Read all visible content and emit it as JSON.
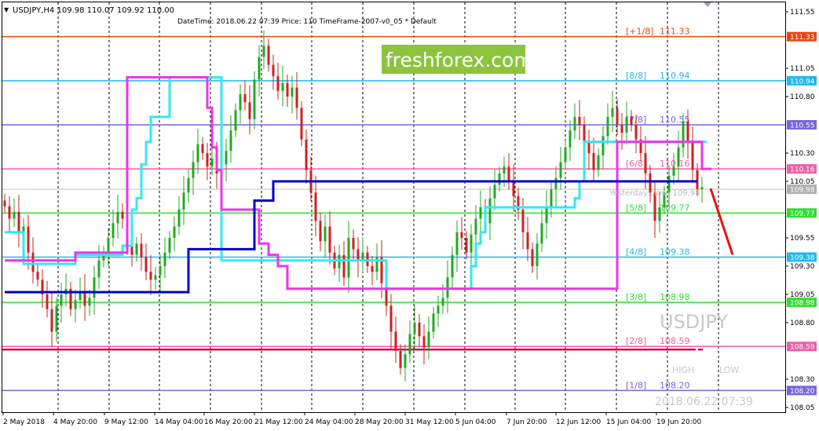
{
  "header": {
    "symbol_line": "USDJPY,H4  109.98 110.07 109.92 110.00",
    "info_line": "DateTime: 2018.06.22 07:39    Price: 110    TimeFrame-2007-v0_05    *   Default"
  },
  "watermark": "freshforex.com",
  "overlay": {
    "symbol": "USDJPY",
    "high_label": "HIGH",
    "low_label": "LOW",
    "datetime": "2018.06.22 07:39",
    "yesterday_close": "Yesterday close 109.98"
  },
  "colors": {
    "bull": "#22aa22",
    "bear": "#cc2222",
    "cyan_line": "#33e8f0",
    "magenta_line": "#ee33ee",
    "blue_line": "#0000cc",
    "arrow": "#ee1111"
  },
  "chart_data": {
    "type": "candlestick",
    "symbol": "USDJPY",
    "timeframe": "H4",
    "ylim": [
      108.05,
      111.55
    ],
    "y_ticks": [
      {
        "value": 111.55,
        "label": "111.55"
      },
      {
        "value": 111.05,
        "label": "111.05"
      },
      {
        "value": 110.8,
        "label": "110.80"
      },
      {
        "value": 110.3,
        "label": "110.30"
      },
      {
        "value": 110.05,
        "label": "110.05"
      },
      {
        "value": 109.55,
        "label": "109.55"
      },
      {
        "value": 109.3,
        "label": "109.30"
      },
      {
        "value": 109.05,
        "label": "109.05"
      },
      {
        "value": 108.8,
        "label": "108.80"
      },
      {
        "value": 108.3,
        "label": "108.30"
      },
      {
        "value": 108.05,
        "label": "108.05"
      }
    ],
    "x_ticks": [
      "2 May 2018",
      "4 May 20:00",
      "9 May 12:00",
      "14 May 04:00",
      "16 May 20:00",
      "21 May 12:00",
      "24 May 04:00",
      "28 May 20:00",
      "31 May 12:00",
      "5 Jun 04:00",
      "7 Jun 20:00",
      "12 Jun 12:00",
      "15 Jun 04:00",
      "19 Jun 20:00"
    ],
    "murrey_levels": [
      {
        "value": 111.33,
        "label": "[+1/8]",
        "tag": "111.33",
        "color": "#ee4411",
        "text": "111.33"
      },
      {
        "value": 110.94,
        "label": "[8/8]",
        "tag": "110.94",
        "color": "#22b7f0",
        "text": "110.94"
      },
      {
        "value": 110.55,
        "label": "[7/8]",
        "tag": "110.55",
        "color": "#7766dd",
        "text": "110.55"
      },
      {
        "value": 110.16,
        "label": "[6/8]",
        "tag": "110.16",
        "color": "#ee5fa7",
        "text": "110.16"
      },
      {
        "value": 109.77,
        "label": "[5/8]",
        "tag": "109.77",
        "color": "#33dd33",
        "text": "109.77"
      },
      {
        "value": 109.38,
        "label": "[4/8]",
        "tag": "109.38",
        "color": "#22b7f0",
        "text": "109.38"
      },
      {
        "value": 108.98,
        "label": "[3/8]",
        "tag": "108.98",
        "color": "#33dd33",
        "text": "108.98"
      },
      {
        "value": 108.59,
        "label": "[2/8]",
        "tag": "108.59",
        "color": "#ee5fa7",
        "text": "108.59"
      },
      {
        "value": 108.2,
        "label": "[1/8]",
        "tag": "108.20",
        "color": "#7766dd",
        "text": "108.20"
      }
    ],
    "current_price_tag": {
      "value": 109.98,
      "tag": "109.98"
    },
    "candle_closes": [
      109.83,
      109.72,
      109.78,
      109.6,
      109.65,
      109.42,
      109.25,
      109.18,
      109.05,
      108.92,
      108.72,
      108.95,
      109.05,
      109.1,
      108.92,
      109.0,
      109.08,
      108.95,
      109.02,
      109.2,
      109.35,
      109.42,
      109.55,
      109.68,
      109.78,
      109.72,
      109.55,
      109.4,
      109.5,
      109.38,
      109.25,
      109.18,
      109.22,
      109.3,
      109.42,
      109.55,
      109.65,
      109.8,
      109.95,
      110.08,
      110.22,
      110.38,
      110.3,
      110.18,
      110.25,
      110.12,
      110.2,
      110.32,
      110.5,
      110.68,
      110.82,
      110.75,
      110.6,
      110.95,
      111.15,
      111.25,
      111.08,
      110.98,
      110.85,
      110.92,
      110.8,
      110.88,
      110.7,
      110.42,
      110.15,
      109.95,
      109.7,
      109.52,
      109.65,
      109.42,
      109.28,
      109.4,
      109.2,
      109.55,
      109.45,
      109.35,
      109.42,
      109.3,
      109.25,
      109.38,
      109.15,
      108.95,
      108.72,
      108.55,
      108.4,
      108.52,
      108.7,
      108.8,
      108.68,
      108.58,
      108.72,
      108.88,
      108.95,
      109.02,
      109.2,
      109.4,
      109.6,
      109.55,
      109.42,
      109.58,
      109.72,
      109.82,
      109.68,
      109.9,
      110.02,
      110.12,
      110.18,
      110.05,
      109.92,
      109.8,
      109.6,
      109.45,
      109.3,
      109.5,
      109.68,
      109.82,
      109.98,
      110.08,
      110.22,
      110.35,
      110.5,
      110.62,
      110.55,
      110.4,
      110.3,
      110.15,
      110.28,
      110.45,
      110.62,
      110.7,
      110.55,
      110.48,
      110.62,
      110.55,
      110.42,
      110.3,
      110.12,
      109.95,
      109.7,
      109.82,
      109.95,
      110.1,
      110.18,
      110.35,
      110.58,
      110.4,
      110.15,
      109.98,
      110.0
    ],
    "series": [
      {
        "name": "",
        "style": "step",
        "color": "#33e8f0",
        "values": [
          109.6,
          109.6,
          109.6,
          109.6,
          109.32,
          109.32,
          109.32,
          109.32,
          109.32,
          109.32,
          109.32,
          109.32,
          109.32,
          109.32,
          109.32,
          109.4,
          109.4,
          109.4,
          109.4,
          109.4,
          109.4,
          109.4,
          109.4,
          109.4,
          109.4,
          109.48,
          109.48,
          109.8,
          109.9,
          110.2,
          110.4,
          110.62,
          110.62,
          110.62,
          110.62,
          110.97,
          110.97,
          110.97,
          110.97,
          110.97,
          110.97,
          110.97,
          110.97,
          110.97,
          110.97,
          110.97,
          109.35,
          109.35,
          109.35,
          109.35,
          109.35,
          109.35,
          109.35,
          109.35,
          109.35,
          109.35,
          109.35,
          109.35,
          109.35,
          109.35,
          109.35,
          109.35,
          109.35,
          109.35,
          109.35,
          109.35,
          109.35,
          109.35,
          109.35,
          109.35,
          109.35,
          109.35,
          109.35,
          109.35,
          109.35,
          109.35,
          109.35,
          109.35,
          109.35,
          109.35,
          109.35,
          109.1,
          109.1,
          109.1,
          109.1,
          109.1,
          109.1,
          109.1,
          109.1,
          109.1,
          109.1,
          109.1,
          109.1,
          109.1,
          109.1,
          109.1,
          109.1,
          109.1,
          109.1,
          109.3,
          109.5,
          109.6,
          109.82,
          109.82,
          109.82,
          109.82,
          109.82,
          109.82,
          109.82,
          109.82,
          109.82,
          109.82,
          109.82,
          109.82,
          109.82,
          109.82,
          109.82,
          109.82,
          109.82,
          109.82,
          109.82,
          109.9,
          110.05,
          110.4,
          110.4,
          110.4,
          110.4,
          110.4,
          110.4,
          110.4,
          110.4,
          110.4,
          110.4,
          110.4,
          110.4,
          110.4,
          110.4,
          110.4,
          110.4,
          110.4,
          110.4,
          110.4,
          110.4,
          110.4,
          110.4,
          110.4,
          110.4,
          110.4,
          110.4,
          110.4
        ]
      },
      {
        "name": "",
        "style": "step",
        "color": "#ee33ee",
        "values": [
          109.35,
          109.35,
          109.35,
          109.35,
          109.35,
          109.35,
          109.35,
          109.35,
          109.35,
          109.35,
          109.35,
          109.35,
          109.35,
          109.35,
          109.35,
          109.42,
          109.42,
          109.42,
          109.42,
          109.42,
          109.42,
          109.42,
          109.42,
          109.42,
          109.42,
          109.42,
          110.97,
          110.97,
          110.97,
          110.97,
          110.97,
          110.97,
          110.97,
          110.97,
          110.97,
          110.97,
          110.97,
          110.97,
          110.97,
          110.97,
          110.97,
          110.97,
          110.97,
          110.7,
          110.35,
          110.15,
          109.8,
          109.8,
          109.8,
          109.8,
          109.8,
          109.8,
          109.8,
          109.8,
          109.5,
          109.5,
          109.4,
          109.4,
          109.3,
          109.3,
          109.1,
          109.1,
          109.1,
          109.1,
          109.1,
          109.1,
          109.1,
          109.1,
          109.1,
          109.1,
          109.1,
          109.1,
          109.1,
          109.1,
          109.1,
          109.1,
          109.1,
          109.1,
          109.1,
          109.1,
          109.1,
          109.1,
          109.1,
          109.1,
          109.1,
          109.1,
          109.1,
          109.1,
          109.1,
          109.1,
          109.1,
          109.1,
          109.1,
          109.1,
          109.1,
          109.1,
          109.1,
          109.1,
          109.1,
          109.1,
          109.1,
          109.1,
          109.1,
          109.1,
          109.1,
          109.1,
          109.1,
          109.1,
          109.1,
          109.1,
          109.1,
          109.1,
          109.1,
          109.1,
          109.1,
          109.1,
          109.1,
          109.1,
          109.1,
          109.1,
          109.1,
          109.1,
          109.1,
          109.1,
          109.1,
          109.1,
          109.1,
          109.1,
          109.1,
          109.1,
          110.4,
          110.4,
          110.4,
          110.4,
          110.4,
          110.4,
          110.4,
          110.4,
          110.4,
          110.4,
          110.4,
          110.4,
          110.4,
          110.4,
          110.4,
          110.4,
          110.4,
          110.4,
          110.16,
          110.16,
          110.16
        ]
      },
      {
        "name": "",
        "style": "step",
        "color": "#0000cc",
        "values": [
          109.07,
          109.07,
          109.07,
          109.07,
          109.07,
          109.07,
          109.07,
          109.07,
          109.07,
          109.07,
          109.07,
          109.07,
          109.07,
          109.07,
          109.07,
          109.07,
          109.07,
          109.07,
          109.07,
          109.07,
          109.07,
          109.07,
          109.07,
          109.07,
          109.07,
          109.07,
          109.07,
          109.07,
          109.07,
          109.07,
          109.07,
          109.07,
          109.07,
          109.07,
          109.07,
          109.07,
          109.07,
          109.07,
          109.07,
          109.45,
          109.45,
          109.45,
          109.45,
          109.45,
          109.45,
          109.45,
          109.45,
          109.45,
          109.45,
          109.45,
          109.45,
          109.45,
          109.45,
          109.88,
          109.88,
          109.88,
          109.88,
          110.05,
          110.05,
          110.05,
          110.05,
          110.05,
          110.05,
          110.05,
          110.05,
          110.05,
          110.05,
          110.05,
          110.05,
          110.05,
          110.05,
          110.05,
          110.05,
          110.05,
          110.05,
          110.05,
          110.05,
          110.05,
          110.05,
          110.05,
          110.05,
          110.05,
          110.05,
          110.05,
          110.05,
          110.05,
          110.05,
          110.05,
          110.05,
          110.05,
          110.05,
          110.05,
          110.05,
          110.05,
          110.05,
          110.05,
          110.05,
          110.05,
          110.05,
          110.05,
          110.05,
          110.05,
          110.05,
          110.05,
          110.05,
          110.05,
          110.05,
          110.05,
          110.05,
          110.05,
          110.05,
          110.05,
          110.05,
          110.05,
          110.05,
          110.05,
          110.05,
          110.05,
          110.05,
          110.05,
          110.05,
          110.05,
          110.05,
          110.05,
          110.05,
          110.05,
          110.05,
          110.05,
          110.05,
          110.05,
          110.05,
          110.05,
          110.05,
          110.05,
          110.05,
          110.05,
          110.05,
          110.05,
          110.05,
          110.05,
          110.05,
          110.05,
          110.05,
          110.05,
          110.05,
          110.05,
          110.05,
          110.05
        ]
      }
    ],
    "projection": {
      "from": 110.0,
      "to": 109.38
    }
  }
}
